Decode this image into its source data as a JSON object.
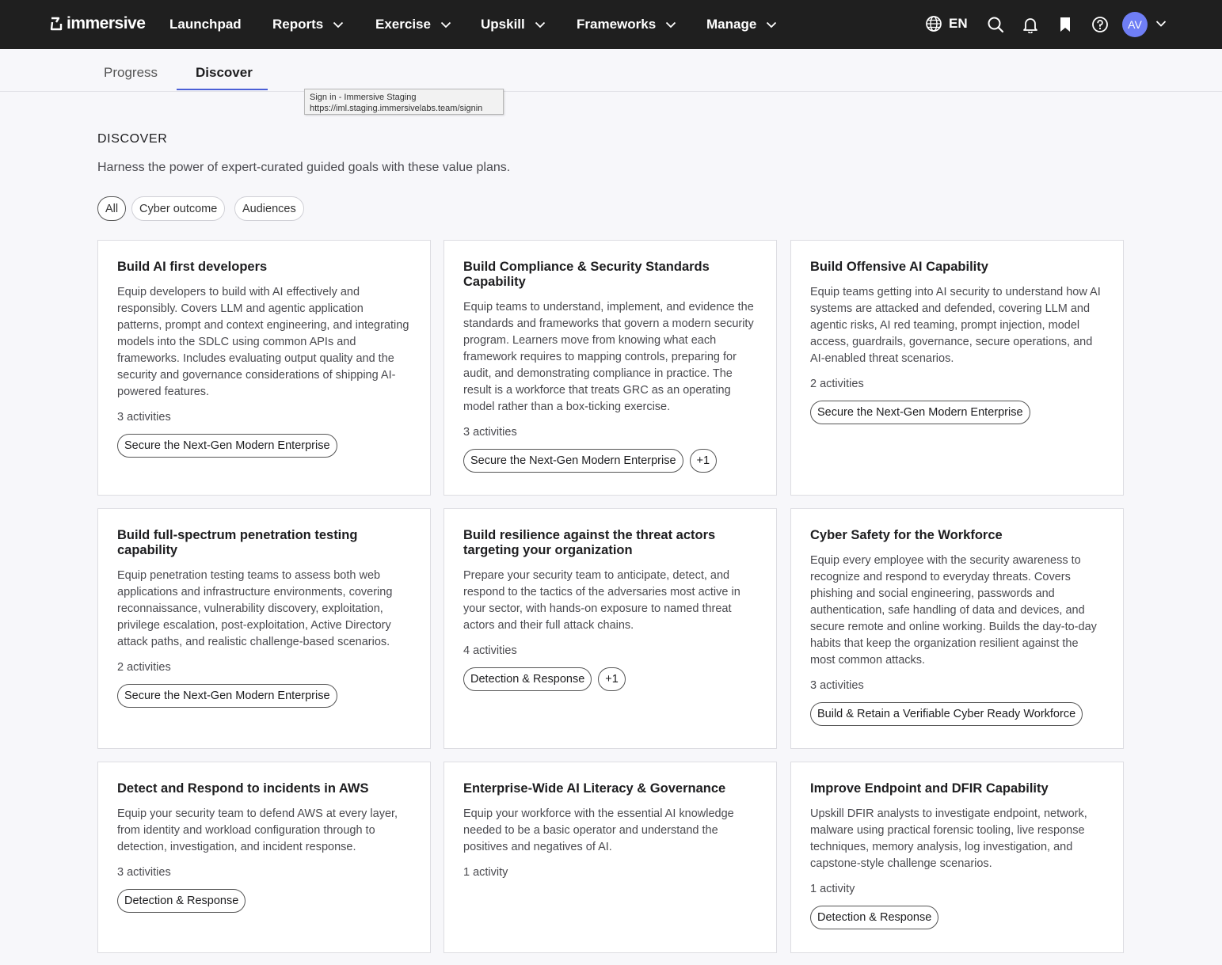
{
  "nav": {
    "logo_text": "immersive",
    "items": [
      {
        "label": "Launchpad",
        "has_menu": false
      },
      {
        "label": "Reports",
        "has_menu": true
      },
      {
        "label": "Exercise",
        "has_menu": true
      },
      {
        "label": "Upskill",
        "has_menu": true
      },
      {
        "label": "Frameworks",
        "has_menu": true
      },
      {
        "label": "Manage",
        "has_menu": true
      }
    ],
    "language": "EN",
    "avatar_initials": "AV",
    "icons": [
      "globe-icon",
      "search-icon",
      "bell-icon",
      "bookmark-icon",
      "help-icon",
      "chevron-down-icon"
    ]
  },
  "tabs": [
    {
      "label": "Progress",
      "active": false
    },
    {
      "label": "Discover",
      "active": true
    }
  ],
  "tooltip": {
    "line1": "Sign in - Immersive Staging",
    "line2": "https://iml.staging.immersivelabs.team/signin"
  },
  "page": {
    "title": "DISCOVER",
    "subtitle": "Harness the power of expert-curated guided goals with these value plans."
  },
  "filters": [
    {
      "label": "All",
      "active": true
    },
    {
      "label": "Cyber outcome",
      "active": false
    },
    {
      "label": "Audiences",
      "active": false
    }
  ],
  "cards": [
    {
      "title": "Build AI first developers",
      "description": "Equip developers to build with AI effectively and responsibly. Covers LLM and agentic application patterns, prompt and context engineering, and integrating models into the SDLC using common APIs and frameworks. Includes evaluating output quality and the security and governance considerations of shipping AI-powered features.",
      "count": "3 activities",
      "tags": [
        "Secure the Next-Gen Modern Enterprise"
      ]
    },
    {
      "title": "Build Compliance & Security Standards Capability",
      "description": "Equip teams to understand, implement, and evidence the standards and frameworks that govern a modern security program. Learners move from knowing what each framework requires to mapping controls, preparing for audit, and demonstrating compliance in practice. The result is a workforce that treats GRC as an operating model rather than a box-ticking exercise.",
      "count": "3 activities",
      "tags": [
        "Secure the Next-Gen Modern Enterprise",
        "+1"
      ]
    },
    {
      "title": "Build Offensive AI Capability",
      "description": "Equip teams getting into AI security to understand how AI systems are attacked and defended, covering LLM and agentic risks, AI red teaming, prompt injection, model access, guardrails, governance, secure operations, and AI-enabled threat scenarios.",
      "count": "2 activities",
      "tags": [
        "Secure the Next-Gen Modern Enterprise"
      ]
    },
    {
      "title": "Build full-spectrum penetration testing capability",
      "description": "Equip penetration testing teams to assess both web applications and infrastructure environments, covering reconnaissance, vulnerability discovery, exploitation, privilege escalation, post-exploitation, Active Directory attack paths, and realistic challenge-based scenarios.",
      "count": "2 activities",
      "tags": [
        "Secure the Next-Gen Modern Enterprise"
      ]
    },
    {
      "title": "Build resilience against the threat actors targeting your organization",
      "description": "Prepare your security team to anticipate, detect, and respond to the tactics of the adversaries most active in your sector, with hands-on exposure to named threat actors and their full attack chains.",
      "count": "4 activities",
      "tags": [
        "Detection & Response",
        "+1"
      ]
    },
    {
      "title": "Cyber Safety for the Workforce",
      "description": "Equip every employee with the security awareness to recognize and respond to everyday threats. Covers phishing and social engineering, passwords and authentication, safe handling of data and devices, and secure remote and online working. Builds the day-to-day habits that keep the organization resilient against the most common attacks.",
      "count": "3 activities",
      "tags": [
        "Build & Retain a Verifiable Cyber Ready Workforce"
      ]
    },
    {
      "title": "Detect and Respond to incidents in AWS",
      "description": "Equip your security team to defend AWS at every layer, from identity and workload configuration through to detection, investigation, and incident response.",
      "count": "3 activities",
      "tags": [
        "Detection & Response"
      ]
    },
    {
      "title": "Enterprise-Wide AI Literacy & Governance",
      "description": "Equip your workforce with the essential AI knowledge needed to be a basic operator and understand the positives and negatives of AI.",
      "count": "1 activity",
      "tags": []
    },
    {
      "title": "Improve Endpoint and DFIR Capability",
      "description": "Upskill DFIR analysts to investigate endpoint, network, malware using practical forensic tooling, live response techniques, memory analysis, log investigation, and capstone-style challenge scenarios.",
      "count": "1 activity",
      "tags": [
        "Detection & Response"
      ]
    }
  ]
}
